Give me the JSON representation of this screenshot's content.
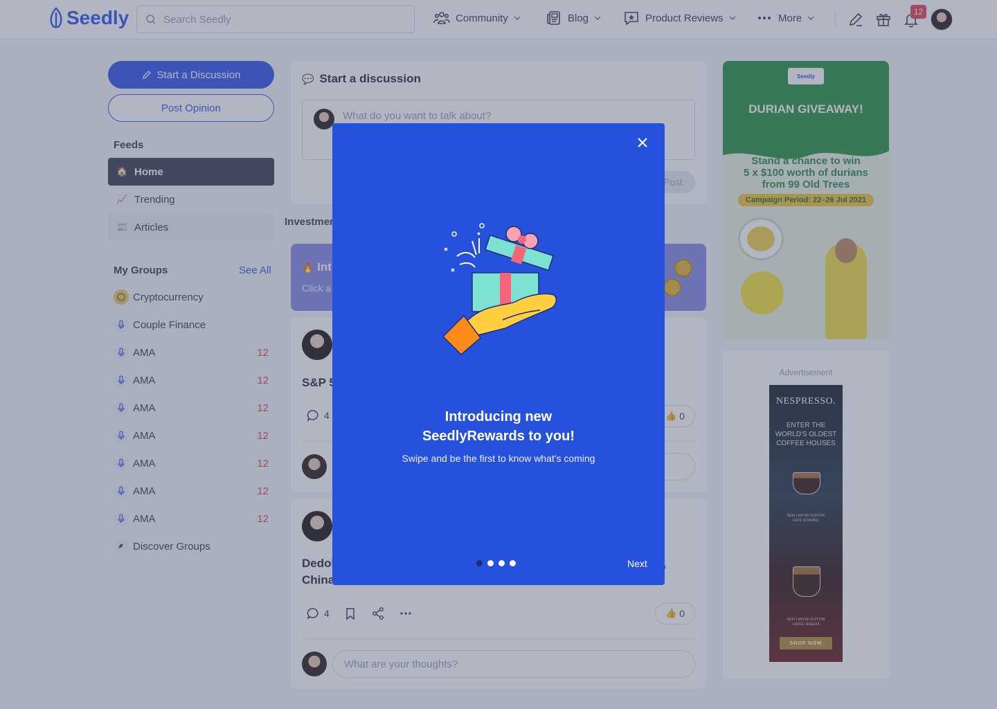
{
  "header": {
    "brand": "Seedly",
    "search_placeholder": "Search Seedly",
    "nav": [
      {
        "label": "Community",
        "icon": "community-icon"
      },
      {
        "label": "Blog",
        "icon": "blog-icon"
      },
      {
        "label": "Product Reviews",
        "icon": "reviews-icon"
      },
      {
        "label": "More",
        "icon": "more-dots-icon"
      }
    ],
    "notification_count": "12"
  },
  "sidebar": {
    "start_discussion": "Start a Discussion",
    "post_opinion": "Post Opinion",
    "feeds_heading": "Feeds",
    "feeds": [
      {
        "label": "Home",
        "emoji": "🏠"
      },
      {
        "label": "Trending",
        "emoji": "📈"
      },
      {
        "label": "Articles",
        "emoji": "📰"
      }
    ],
    "groups_heading": "My Groups",
    "see_all": "See All",
    "groups": [
      {
        "label": "Cryptocurrency",
        "count": ""
      },
      {
        "label": "Couple Finance",
        "count": ""
      },
      {
        "label": "AMA",
        "count": "12"
      },
      {
        "label": "AMA",
        "count": "12"
      },
      {
        "label": "AMA",
        "count": "12"
      },
      {
        "label": "AMA",
        "count": "12"
      },
      {
        "label": "AMA",
        "count": "12"
      },
      {
        "label": "AMA",
        "count": "12"
      },
      {
        "label": "AMA",
        "count": "12"
      }
    ],
    "discover": "Discover Groups"
  },
  "main": {
    "discussion": {
      "title": "Start a discussion",
      "placeholder": "What do you want to talk about?",
      "post_label": "Post"
    },
    "tab_visible": "Investmen",
    "promo": {
      "title": "Int",
      "subtitle": "Click a"
    },
    "posts": [
      {
        "title": "S&P 5",
        "comments": "4",
        "likes": "0"
      },
      {
        "title_line1": "Dedol",
        "title_line2": "China",
        "comments": "4",
        "likes": "0",
        "trailing": ","
      }
    ],
    "comment_placeholder": "What are your thoughts?"
  },
  "right": {
    "durian_ad": {
      "brand": "Seedly",
      "heading": "DURIAN GIVEAWAY!",
      "body_line1": "Stand a chance to win",
      "body_line2": "5 x $100 worth of durians",
      "body_line3": "from 99 Old Trees",
      "period": "Campaign Period: 22–26 Jul 2021"
    },
    "advertisement_label": "Advertisement",
    "nespresso": {
      "logo": "NESPRESSO.",
      "tagline_1": "ENTER THE",
      "tagline_2": "WORLD'S OLDEST",
      "tagline_3": "COFFEE HOUSES",
      "edition_1a": "NEW LIMITED EDITION",
      "edition_1b": "CAFÉ ISTANBUL",
      "edition_2a": "NEW LIMITED EDITION",
      "edition_2b": "CAFFÈ VENEZIA",
      "shop": "SHOP NOW"
    }
  },
  "modal": {
    "title_line1": "Introducing new",
    "title_line2": "SeedlyRewards to you!",
    "subtitle": "Swipe and be the first to know what's coming",
    "next_label": "Next",
    "slides_total": 4,
    "active_slide": 1
  },
  "colors": {
    "brand_blue": "#3257ea",
    "modal_blue": "#2551dc",
    "badge_red": "#e34850",
    "sidebar_active": "#3d4150"
  }
}
